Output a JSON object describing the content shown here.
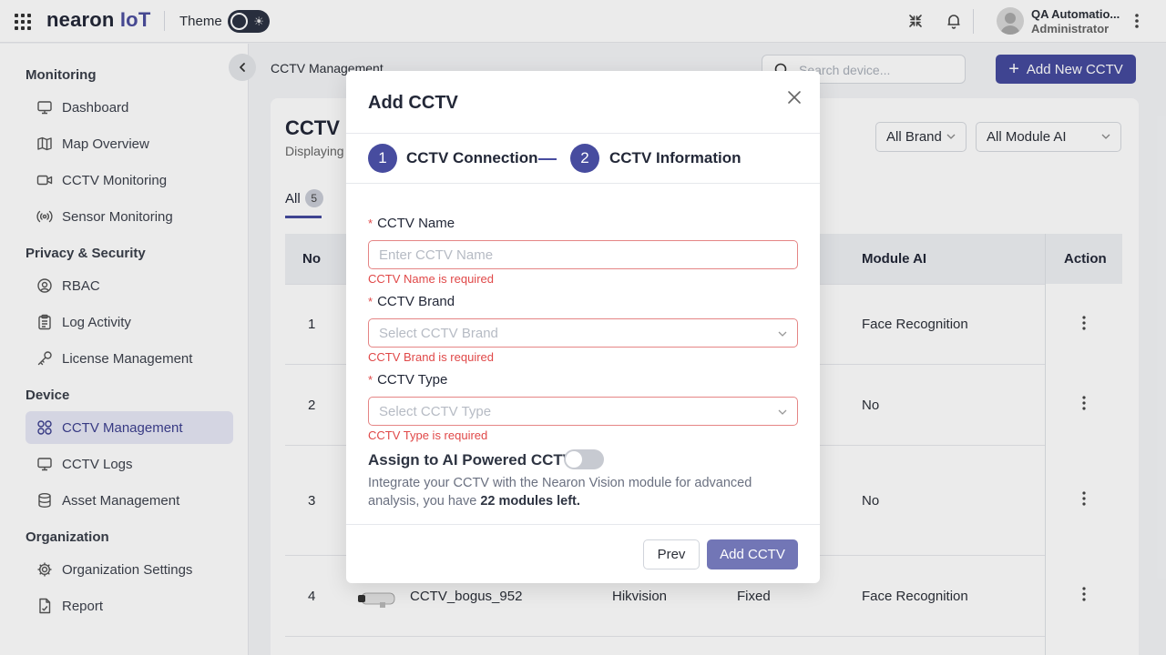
{
  "topbar": {
    "logo_main": "nearon",
    "logo_iot": "IoT",
    "theme_label": "Theme",
    "user_name": "QA Automatio...",
    "user_role": "Administrator"
  },
  "sidebar": {
    "sections": [
      {
        "title": "Monitoring",
        "items": [
          {
            "label": "Dashboard",
            "icon": "monitor-icon"
          },
          {
            "label": "Map Overview",
            "icon": "map-icon"
          },
          {
            "label": "CCTV Monitoring",
            "icon": "video-icon"
          },
          {
            "label": "Sensor Monitoring",
            "icon": "sensor-icon"
          }
        ]
      },
      {
        "title": "Privacy & Security",
        "items": [
          {
            "label": "RBAC",
            "icon": "rbac-icon"
          },
          {
            "label": "Log Activity",
            "icon": "clipboard-icon"
          },
          {
            "label": "License Management",
            "icon": "key-icon"
          }
        ]
      },
      {
        "title": "Device",
        "items": [
          {
            "label": "CCTV Management",
            "icon": "grid-icon",
            "active": true
          },
          {
            "label": "CCTV Logs",
            "icon": "monitor-icon"
          },
          {
            "label": "Asset Management",
            "icon": "database-icon"
          }
        ]
      },
      {
        "title": "Organization",
        "items": [
          {
            "label": "Organization Settings",
            "icon": "gear-icon"
          },
          {
            "label": "Report",
            "icon": "report-icon"
          }
        ]
      }
    ]
  },
  "main": {
    "breadcrumb": "CCTV Management",
    "search_placeholder": "Search device...",
    "add_button": "Add New CCTV",
    "panel_title": "CCTV D",
    "panel_subtitle": "Displaying",
    "filters": {
      "brand": "All Brand",
      "module": "All Module AI"
    },
    "tab_all": {
      "label": "All",
      "count": "5"
    },
    "table": {
      "headers": {
        "no": "No",
        "module": "Module AI",
        "action": "Action"
      },
      "rows": [
        {
          "no": "1",
          "module": "Face Recognition"
        },
        {
          "no": "2",
          "module": "No"
        },
        {
          "no": "3",
          "module": "No"
        },
        {
          "no": "4",
          "name": "CCTV_bogus_952",
          "brand": "Hikvision",
          "type": "Fixed",
          "module": "Face Recognition"
        }
      ]
    }
  },
  "modal": {
    "title": "Add CCTV",
    "steps": [
      {
        "num": "1",
        "label": "CCTV Connection"
      },
      {
        "num": "2",
        "label": "CCTV Information"
      }
    ],
    "required_mark": "*",
    "fields": {
      "name": {
        "label": "CCTV Name",
        "placeholder": "Enter CCTV Name",
        "error": "CCTV Name is required"
      },
      "brand": {
        "label": "CCTV Brand",
        "placeholder": "Select CCTV Brand",
        "error": "CCTV Brand is required"
      },
      "type": {
        "label": "CCTV Type",
        "placeholder": "Select CCTV Type",
        "error": "CCTV Type is required"
      }
    },
    "ai": {
      "title": "Assign to AI Powered CCTV",
      "desc_prefix": "Integrate your CCTV with the Nearon Vision module for advanced analysis, you have ",
      "desc_bold": "22 modules left.",
      "enabled": false
    },
    "buttons": {
      "prev": "Prev",
      "submit": "Add CCTV"
    }
  },
  "colors": {
    "accent": "#454a9e",
    "error": "#e04848",
    "active_bg": "#e7e8f6"
  }
}
